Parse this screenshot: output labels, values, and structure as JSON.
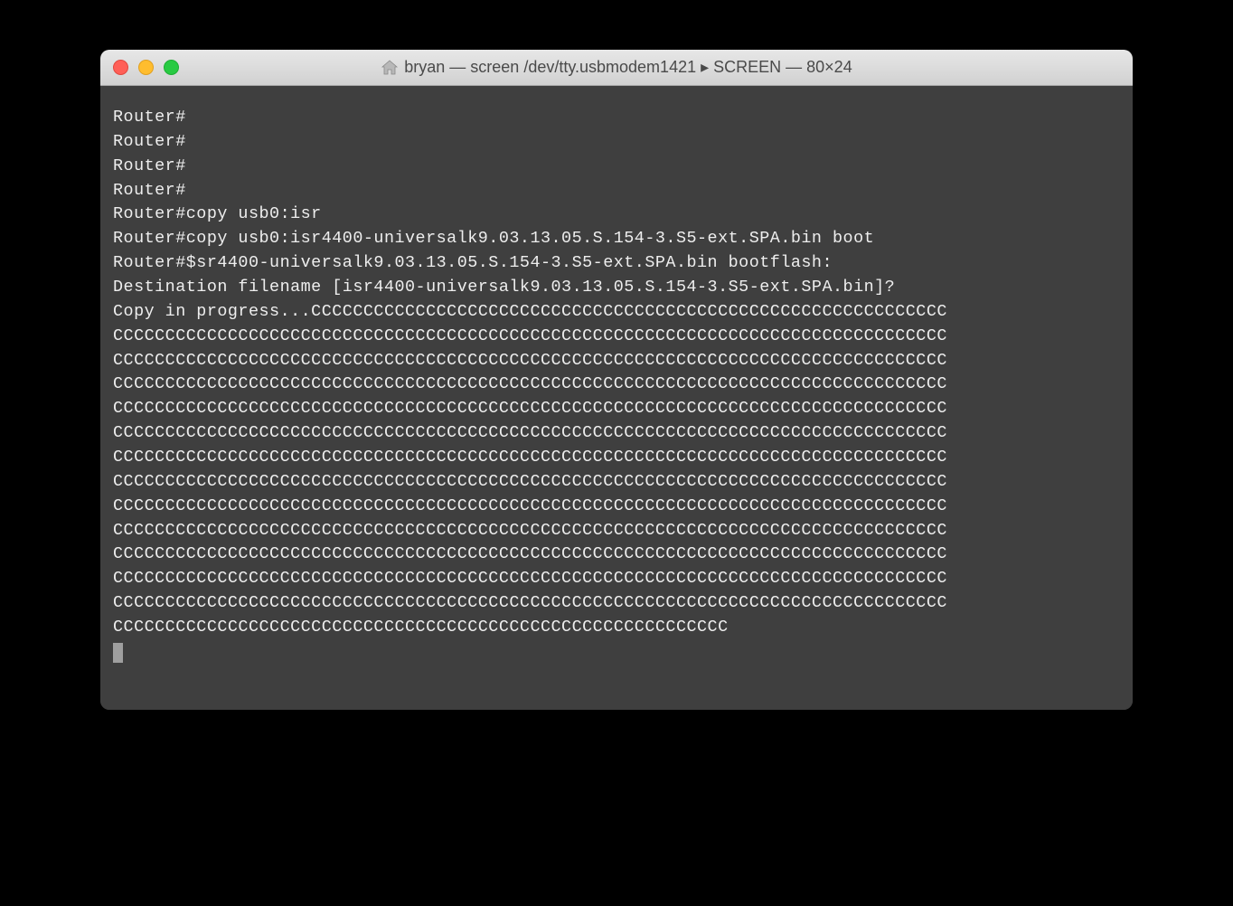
{
  "window": {
    "title": "bryan — screen /dev/tty.usbmodem1421 ▸ SCREEN — 80×24",
    "home_user": "bryan"
  },
  "terminal": {
    "lines": [
      "Router#",
      "Router#",
      "Router#",
      "Router#",
      "Router#copy usb0:isr",
      "Router#copy usb0:isr4400-universalk9.03.13.05.S.154-3.S5-ext.SPA.bin boot",
      "Router#$sr4400-universalk9.03.13.05.S.154-3.S5-ext.SPA.bin bootflash:",
      "Destination filename [isr4400-universalk9.03.13.05.S.154-3.S5-ext.SPA.bin]?",
      "Copy in progress...CCCCCCCCCCCCCCCCCCCCCCCCCCCCCCCCCCCCCCCCCCCCCCCCCCCCCCCCCCCCC",
      "CCCCCCCCCCCCCCCCCCCCCCCCCCCCCCCCCCCCCCCCCCCCCCCCCCCCCCCCCCCCCCCCCCCCCCCCCCCCCCCC",
      "CCCCCCCCCCCCCCCCCCCCCCCCCCCCCCCCCCCCCCCCCCCCCCCCCCCCCCCCCCCCCCCCCCCCCCCCCCCCCCCC",
      "CCCCCCCCCCCCCCCCCCCCCCCCCCCCCCCCCCCCCCCCCCCCCCCCCCCCCCCCCCCCCCCCCCCCCCCCCCCCCCCC",
      "CCCCCCCCCCCCCCCCCCCCCCCCCCCCCCCCCCCCCCCCCCCCCCCCCCCCCCCCCCCCCCCCCCCCCCCCCCCCCCCC",
      "CCCCCCCCCCCCCCCCCCCCCCCCCCCCCCCCCCCCCCCCCCCCCCCCCCCCCCCCCCCCCCCCCCCCCCCCCCCCCCCC",
      "CCCCCCCCCCCCCCCCCCCCCCCCCCCCCCCCCCCCCCCCCCCCCCCCCCCCCCCCCCCCCCCCCCCCCCCCCCCCCCCC",
      "CCCCCCCCCCCCCCCCCCCCCCCCCCCCCCCCCCCCCCCCCCCCCCCCCCCCCCCCCCCCCCCCCCCCCCCCCCCCCCCC",
      "CCCCCCCCCCCCCCCCCCCCCCCCCCCCCCCCCCCCCCCCCCCCCCCCCCCCCCCCCCCCCCCCCCCCCCCCCCCCCCCC",
      "CCCCCCCCCCCCCCCCCCCCCCCCCCCCCCCCCCCCCCCCCCCCCCCCCCCCCCCCCCCCCCCCCCCCCCCCCCCCCCCC",
      "CCCCCCCCCCCCCCCCCCCCCCCCCCCCCCCCCCCCCCCCCCCCCCCCCCCCCCCCCCCCCCCCCCCCCCCCCCCCCCCC",
      "CCCCCCCCCCCCCCCCCCCCCCCCCCCCCCCCCCCCCCCCCCCCCCCCCCCCCCCCCCCCCCCCCCCCCCCCCCCCCCCC",
      "CCCCCCCCCCCCCCCCCCCCCCCCCCCCCCCCCCCCCCCCCCCCCCCCCCCCCCCCCCCCCCCCCCCCCCCCCCCCCCCC",
      "CCCCCCCCCCCCCCCCCCCCCCCCCCCCCCCCCCCCCCCCCCCCCCCCCCCCCCCCCCC"
    ]
  }
}
